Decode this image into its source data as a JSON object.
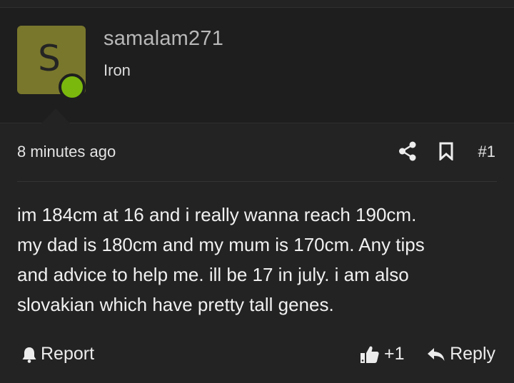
{
  "author": {
    "avatar_letter": "S",
    "avatar_color": "#79772c",
    "online_color": "#7ab80e",
    "username": "samalam271",
    "rank": "Iron"
  },
  "meta": {
    "timestamp": "8 minutes ago",
    "share_icon": "share-icon",
    "bookmark_icon": "bookmark-icon",
    "post_number": "#1"
  },
  "message": "im 184cm at 16 and i really wanna reach 190cm.\nmy dad is 180cm and my mum is 170cm. Any tips\nand advice to help me. ill be 17 in july. i am also\nslovakian which have pretty tall genes.",
  "footer": {
    "report_label": "Report",
    "report_icon": "bell-icon",
    "like_count": "+1",
    "like_icon": "thumbs-up-icon",
    "reply_label": "Reply",
    "reply_icon": "reply-arrow-icon"
  }
}
